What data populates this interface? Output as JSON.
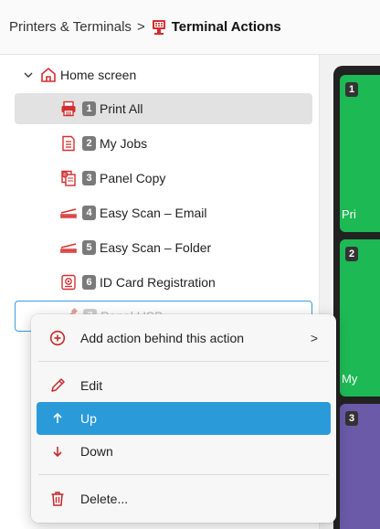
{
  "breadcrumb": {
    "parent": "Printers & Terminals",
    "separator": ">",
    "current": "Terminal Actions"
  },
  "tree": {
    "root": {
      "label": "Home screen",
      "icon": "home-icon",
      "expand_icon": "chevron-down-icon"
    },
    "items": [
      {
        "num": "1",
        "label": "Print All",
        "icon": "printer-icon",
        "selected": true
      },
      {
        "num": "2",
        "label": "My Jobs",
        "icon": "document-list-icon"
      },
      {
        "num": "3",
        "label": "Panel Copy",
        "icon": "copy-icon"
      },
      {
        "num": "4",
        "label": "Easy Scan – Email",
        "icon": "scanner-icon"
      },
      {
        "num": "5",
        "label": "Easy Scan – Folder",
        "icon": "scanner-icon"
      },
      {
        "num": "6",
        "label": "ID Card Registration",
        "icon": "id-card-icon"
      },
      {
        "num": "7",
        "label": "Panel USB",
        "icon": "usb-icon",
        "focused": true
      }
    ],
    "more_label": "..."
  },
  "context_menu": {
    "add": {
      "label": "Add action behind this action",
      "icon": "plus-circle-icon",
      "submenu": ">"
    },
    "edit": {
      "label": "Edit",
      "icon": "pencil-icon"
    },
    "up": {
      "label": "Up",
      "icon": "arrow-up-icon"
    },
    "down": {
      "label": "Down",
      "icon": "arrow-down-icon"
    },
    "delete": {
      "label": "Delete...",
      "icon": "trash-icon"
    }
  },
  "preview_tiles": [
    {
      "num": "1",
      "label": "Pri",
      "color": "#1db954"
    },
    {
      "num": "2",
      "label": "My",
      "color": "#1db954"
    },
    {
      "num": "3",
      "label": "",
      "color": "#6a5aa8"
    }
  ],
  "colors": {
    "accent": "#2a9ad9",
    "icon_red": "#d32f2f",
    "tile_green": "#1db954",
    "tile_purple": "#6a5aa8"
  }
}
